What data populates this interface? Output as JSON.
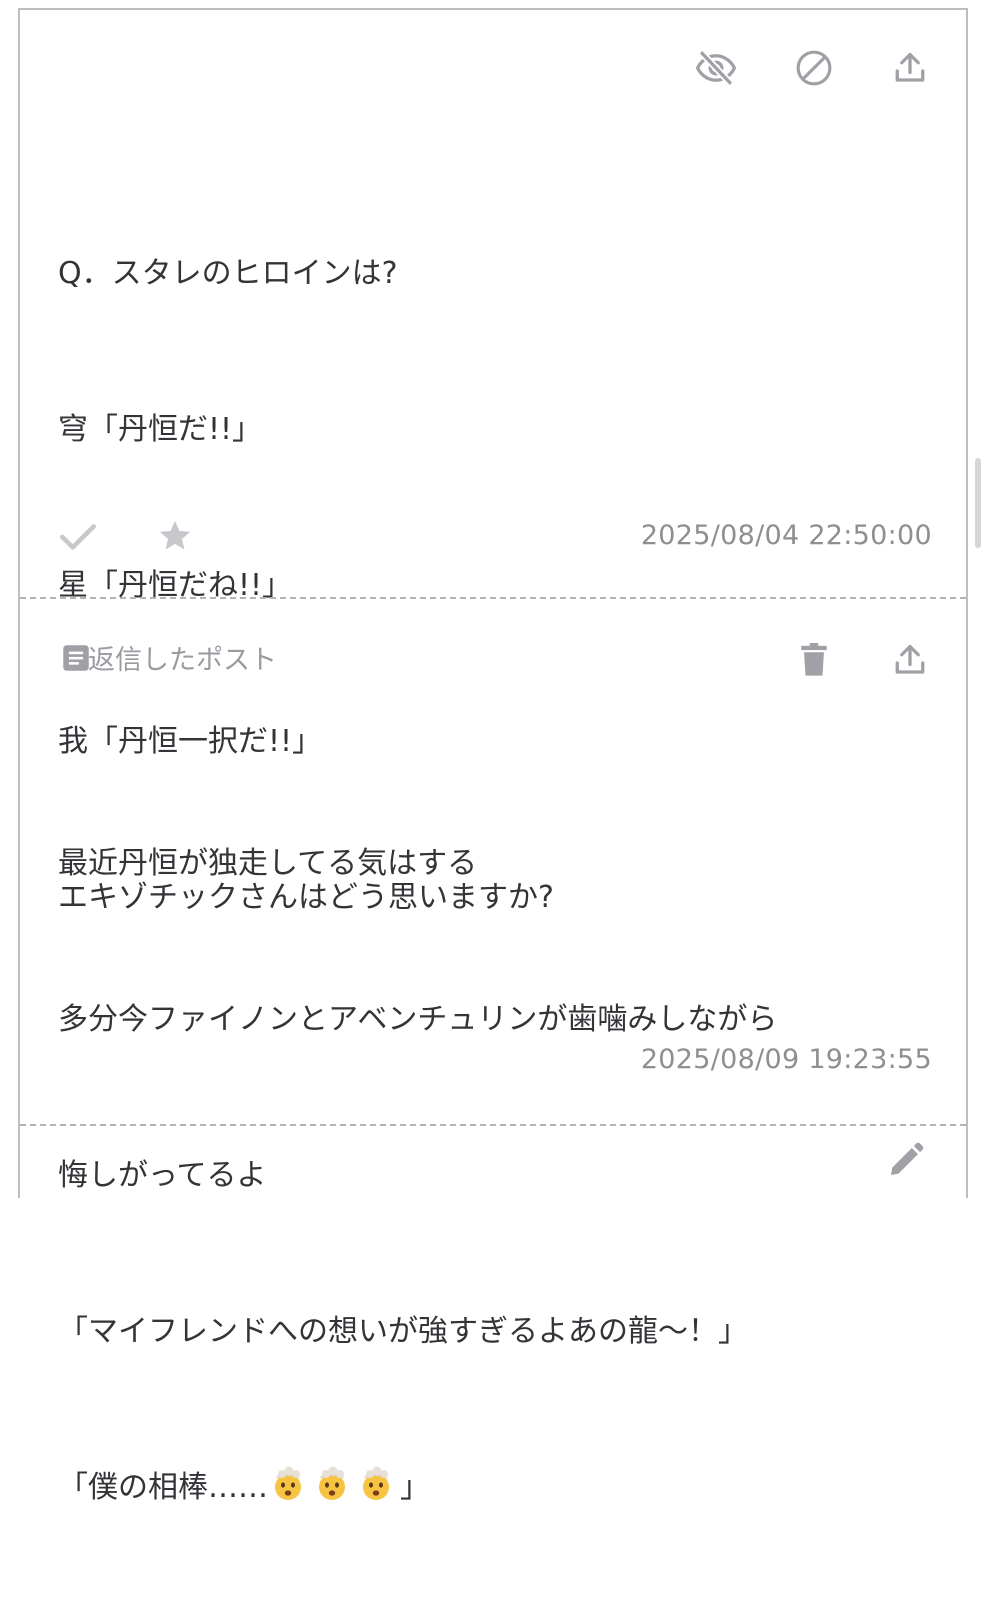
{
  "post": {
    "lines": [
      "Q．スタレのヒロインは?",
      "穹「丹恒だ!!」",
      "星「丹恒だね!!」",
      "我「丹恒一択だ!!」",
      "エキゾチックさんはどう思いますか?"
    ],
    "timestamp": "2025/08/04 22:50:00",
    "icons": {
      "hide": "eye-off-icon",
      "block": "block-icon",
      "share": "share-icon",
      "check": "check-icon",
      "star": "star-icon"
    }
  },
  "reply": {
    "label": "返信したポスト",
    "lines": [
      "最近丹恒が独走してる気はする",
      "多分今ファイノンとアベンチュリンが歯噛みしながら",
      "悔しがってるよ",
      "「マイフレンドへの想いが強すぎるよあの龍〜！」"
    ],
    "last_line_prefix": "「僕の相棒……",
    "last_line_suffix": "」",
    "emoji": [
      "🤯",
      "🤯",
      "🤯"
    ],
    "timestamp": "2025/08/09 19:23:55",
    "icons": {
      "document": "document-icon",
      "delete": "trash-icon",
      "share": "share-icon",
      "edit": "pencil-icon"
    }
  },
  "colors": {
    "icon_gray": "#a0a0a6",
    "icon_light": "#c8c8cc",
    "text": "#333338",
    "meta": "#8e8e93"
  }
}
